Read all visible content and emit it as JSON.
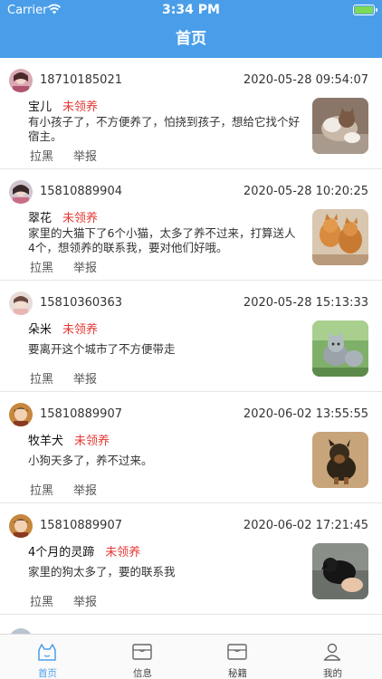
{
  "statusbar": {
    "carrier": "Carrier",
    "time": "3:34 PM"
  },
  "navbar": {
    "title": "首页"
  },
  "posts": [
    {
      "phone": "18710185021",
      "datetime": "2020-05-28 09:54:07",
      "name": "宝儿",
      "status": "未领养",
      "desc": "有小孩子了，不方便养了，怕挠到孩子，想给它找个好宿主。",
      "blacklist": "拉黑",
      "report": "举报"
    },
    {
      "phone": "15810889904",
      "datetime": "2020-05-28 10:20:25",
      "name": "翠花",
      "status": "未领养",
      "desc": "家里的大猫下了6个小猫，太多了养不过来，打算送人4个，想领养的联系我，要对他们好哦。",
      "blacklist": "拉黑",
      "report": "举报"
    },
    {
      "phone": "15810360363",
      "datetime": "2020-05-28 15:13:33",
      "name": "朵米",
      "status": "未领养",
      "desc": "要离开这个城市了不方便带走",
      "blacklist": "拉黑",
      "report": "举报"
    },
    {
      "phone": "15810889907",
      "datetime": "2020-06-02 13:55:55",
      "name": "牧羊犬",
      "status": "未领养",
      "desc": "小狗天多了，养不过来。",
      "blacklist": "拉黑",
      "report": "举报"
    },
    {
      "phone": "15810889907",
      "datetime": "2020-06-02 17:21:45",
      "name": "4个月的灵蹄",
      "status": "未领养",
      "desc": "家里的狗太多了，要的联系我",
      "blacklist": "拉黑",
      "report": "举报"
    }
  ],
  "tabbar": {
    "tabs": [
      {
        "label": "首页",
        "icon": "home-icon"
      },
      {
        "label": "信息",
        "icon": "message-icon"
      },
      {
        "label": "秘籍",
        "icon": "book-icon"
      },
      {
        "label": "我的",
        "icon": "profile-icon"
      }
    ]
  },
  "colors": {
    "primary": "#4a9ee9",
    "status_red": "#e53935"
  }
}
